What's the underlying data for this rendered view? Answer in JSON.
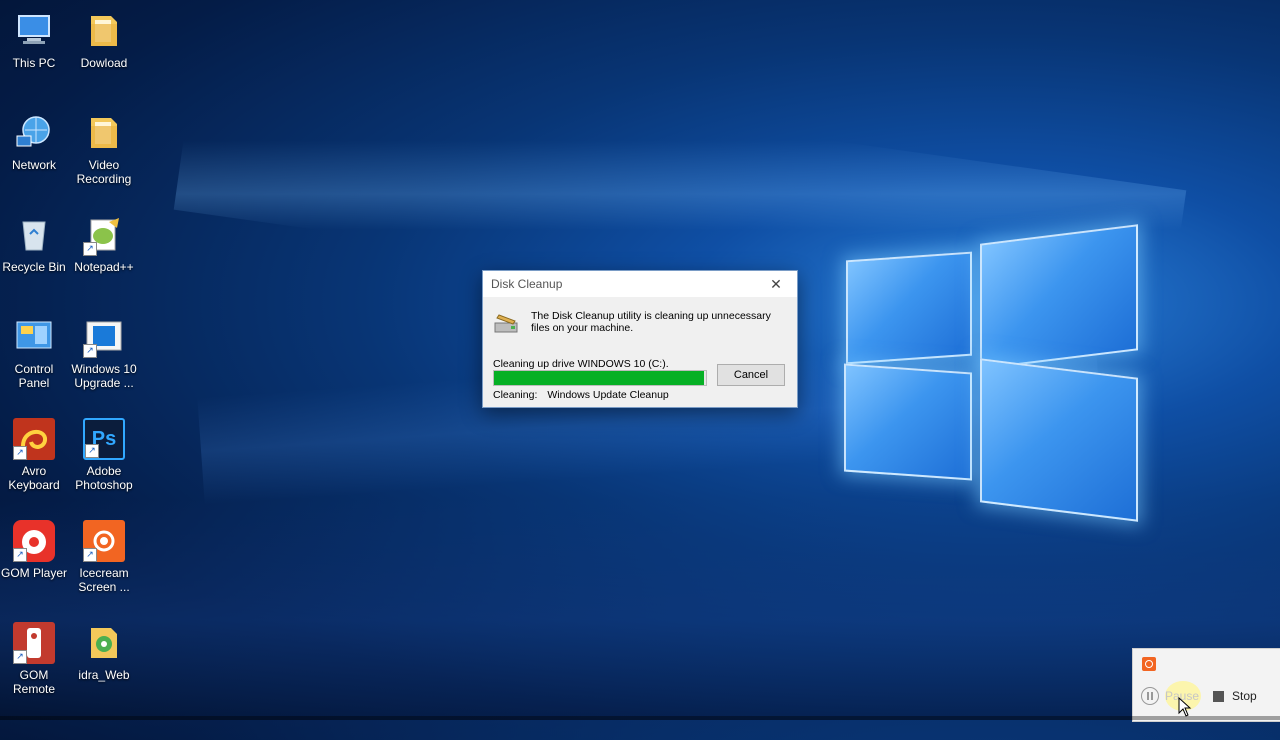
{
  "desktop": {
    "icons": [
      {
        "label": "This PC",
        "icon": "this-pc-icon"
      },
      {
        "label": "Dowload",
        "icon": "folder-icon"
      },
      {
        "label": "Network",
        "icon": "network-icon"
      },
      {
        "label": "Video Recording",
        "icon": "folder-icon"
      },
      {
        "label": "Recycle Bin",
        "icon": "recycle-bin-icon"
      },
      {
        "label": "Notepad++",
        "icon": "notepad-plus-plus-icon"
      },
      {
        "label": "Control Panel",
        "icon": "control-panel-icon"
      },
      {
        "label": "Windows 10 Upgrade ...",
        "icon": "windows-upgrade-icon"
      },
      {
        "label": "Avro Keyboard",
        "icon": "avro-keyboard-icon"
      },
      {
        "label": "Adobe Photoshop",
        "icon": "photoshop-icon",
        "glyph": "Ps"
      },
      {
        "label": "GOM Player",
        "icon": "gom-player-icon"
      },
      {
        "label": "Icecream Screen ...",
        "icon": "icecream-recorder-icon"
      },
      {
        "label": "GOM Remote",
        "icon": "gom-remote-icon"
      },
      {
        "label": "idra_Web",
        "icon": "folder-icon"
      }
    ]
  },
  "dialog": {
    "title": "Disk Cleanup",
    "close_glyph": "✕",
    "message": "The Disk Cleanup utility is cleaning up unnecessary files on your machine.",
    "status": "Cleaning up drive WINDOWS 10 (C:).",
    "progress_fraction": 0.99,
    "cancel_label": "Cancel",
    "cleaning_label": "Cleaning:",
    "cleaning_item": "Windows Update Cleanup"
  },
  "recorder": {
    "pause_label": "Pause",
    "stop_label": "Stop"
  },
  "colors": {
    "progress": "#06b025",
    "recorder_brand": "#f26522"
  }
}
